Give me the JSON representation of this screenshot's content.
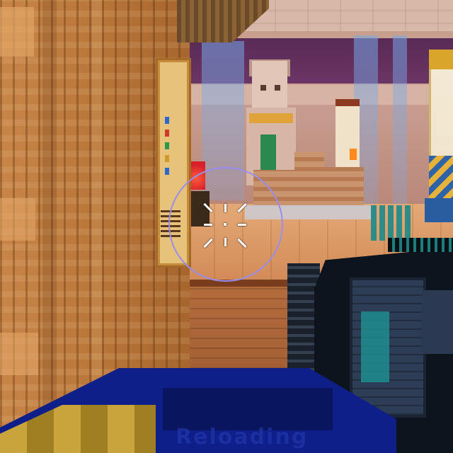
{
  "scene": {
    "description_free": true,
    "hud": {
      "reload_label": "Reloading"
    },
    "crosshair": {
      "type": "circle-reticle",
      "circle_color": "#9a8df0",
      "tick_color": "#ffffff"
    },
    "weapon": {
      "primary_color": "#0e141d",
      "accent_color": "#1e8a8c"
    },
    "colors": {
      "back_wall": "#5a2a57",
      "wood_wall": "#b87538",
      "floor": "#d79a6a",
      "light_beam": "#78aaeb"
    }
  }
}
